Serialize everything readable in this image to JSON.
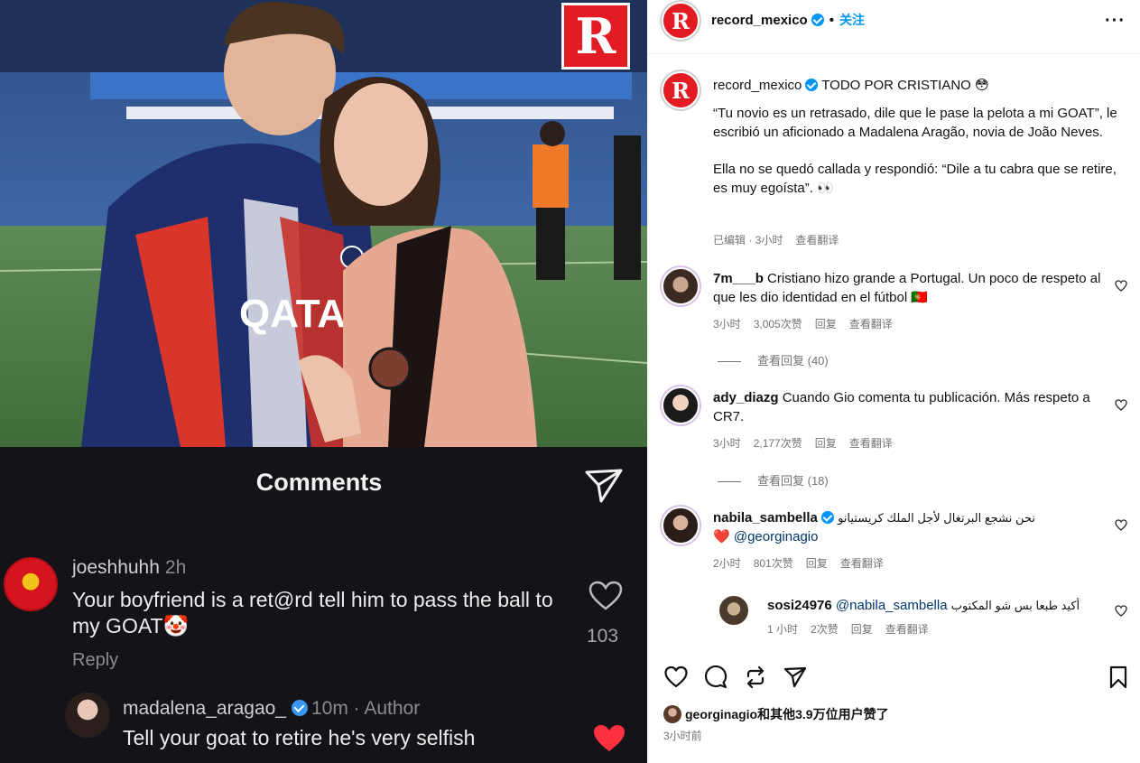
{
  "post": {
    "logo_letter": "R",
    "shot": {
      "title": "Comments",
      "c1_user": "joeshhuhh",
      "c1_time": "2h",
      "c1_text": "Your boyfriend is a ret@rd tell him to pass the ball to my GOAT🤡",
      "c1_reply": "Reply",
      "c1_likes": "103",
      "c2_user": "madalena_aragao_",
      "c2_time": "10m · Author",
      "c2_text": "Tell your goat to retire he's very selfish"
    }
  },
  "header": {
    "avatar_letter": "R",
    "username": "record_mexico",
    "dot": "•",
    "follow": "关注",
    "more": "···"
  },
  "caption": {
    "username": "record_mexico",
    "line1": "TODO POR CRISTIANO 😳",
    "p1": "“Tu novio es un retrasado, dile que le pase la pelota a mi GOAT”, le escribió un aficionado a Madalena Aragão, novia de João Neves.",
    "p2": "Ella no se quedó callada y respondió: “Dile a tu cabra que se retire, es muy egoísta”. 👀",
    "edited": "已编辑 · 3小时",
    "translate": "查看翻译"
  },
  "comments": [
    {
      "user": "7m___b",
      "text": "Cristiano hizo grande a Portugal. Un poco de respeto al que les dio identidad en el fútbol 🇵🇹",
      "time": "3小时",
      "likes": "3,005次赞",
      "reply": "回复",
      "translate": "查看翻译",
      "view_replies": "查看回复 (40)"
    },
    {
      "user": "ady_diazg",
      "text": "Cuando Gio comenta tu publicación. Más respeto a CR7.",
      "time": "3小时",
      "likes": "2,177次赞",
      "reply": "回复",
      "translate": "查看翻译",
      "view_replies": "查看回复 (18)"
    },
    {
      "user": "nabila_sambella",
      "text": "نحن نشجع البرتغال لأجل الملك كريستيانو",
      "text2": "❤️ @georginagio",
      "time": "2小时",
      "likes": "801次赞",
      "reply": "回复",
      "translate": "查看翻译"
    },
    {
      "user": "sosi24976",
      "mention": "@nabila_sambella",
      "text": "أكيد طبعا بس شو المكتوب",
      "time": "1 小时",
      "likes": "2次赞",
      "reply": "回复",
      "translate": "查看翻译"
    }
  ],
  "footer": {
    "likes_user": "georginagio",
    "likes_text": "和其他3.9万位用户赞了",
    "ago": "3小时前"
  }
}
